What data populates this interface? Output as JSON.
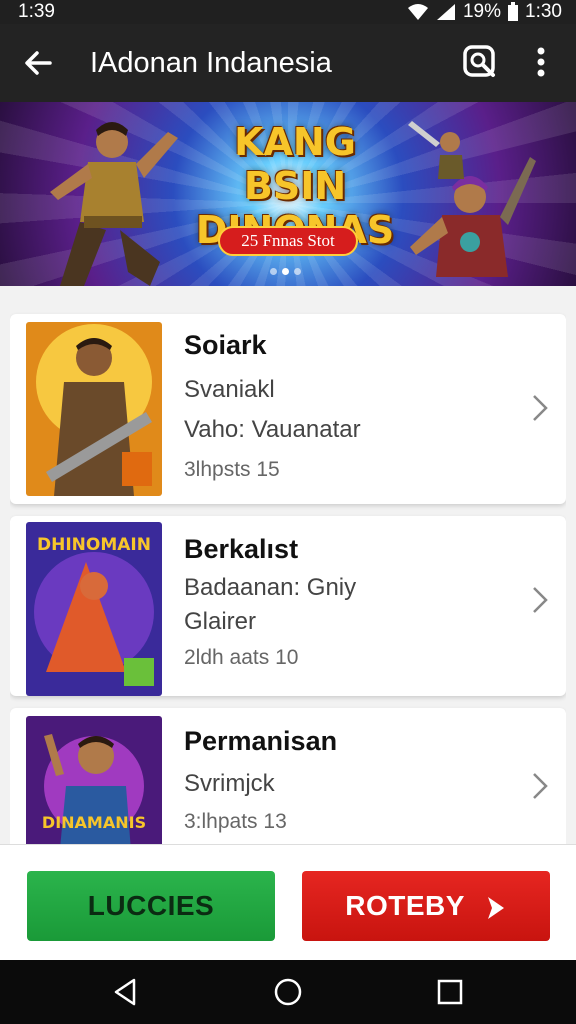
{
  "status_bar": {
    "time_left": "1:39",
    "battery": "19%",
    "time_right": "1:30"
  },
  "app_bar": {
    "title": "IAdonan Indanesia",
    "icons": [
      "back-arrow-icon",
      "search-icon",
      "more-vert-icon"
    ]
  },
  "banner": {
    "title_line1": "KANG BSIN",
    "title_line2": "DINONAS",
    "badge": "25 Fnnas Stot",
    "slide_count": 3,
    "active_slide": 2
  },
  "list": {
    "items": [
      {
        "name": "Soiark",
        "line1": "Svaniakl",
        "line2": "Vaho: Vauanatar",
        "meta": "3lhpsts 15"
      },
      {
        "name": "Berkalıst",
        "line1": "Badaanan: Gniy",
        "line2": "Glairer",
        "meta": "2ldh aats 10"
      },
      {
        "name": "Permanisan",
        "line1": "Svrimjck",
        "line2": "",
        "meta": "3:lhpats 13"
      }
    ],
    "thumb_labels": [
      "",
      "DHINOMAIN",
      "DINAMANIS"
    ]
  },
  "buttons": {
    "left_label": "LUCCIES",
    "right_label": "ROTEBY"
  },
  "colors": {
    "app_bar": "#232323",
    "green": "#1fa63f",
    "red": "#d81c16",
    "banner_gold": "#f7c52a"
  }
}
